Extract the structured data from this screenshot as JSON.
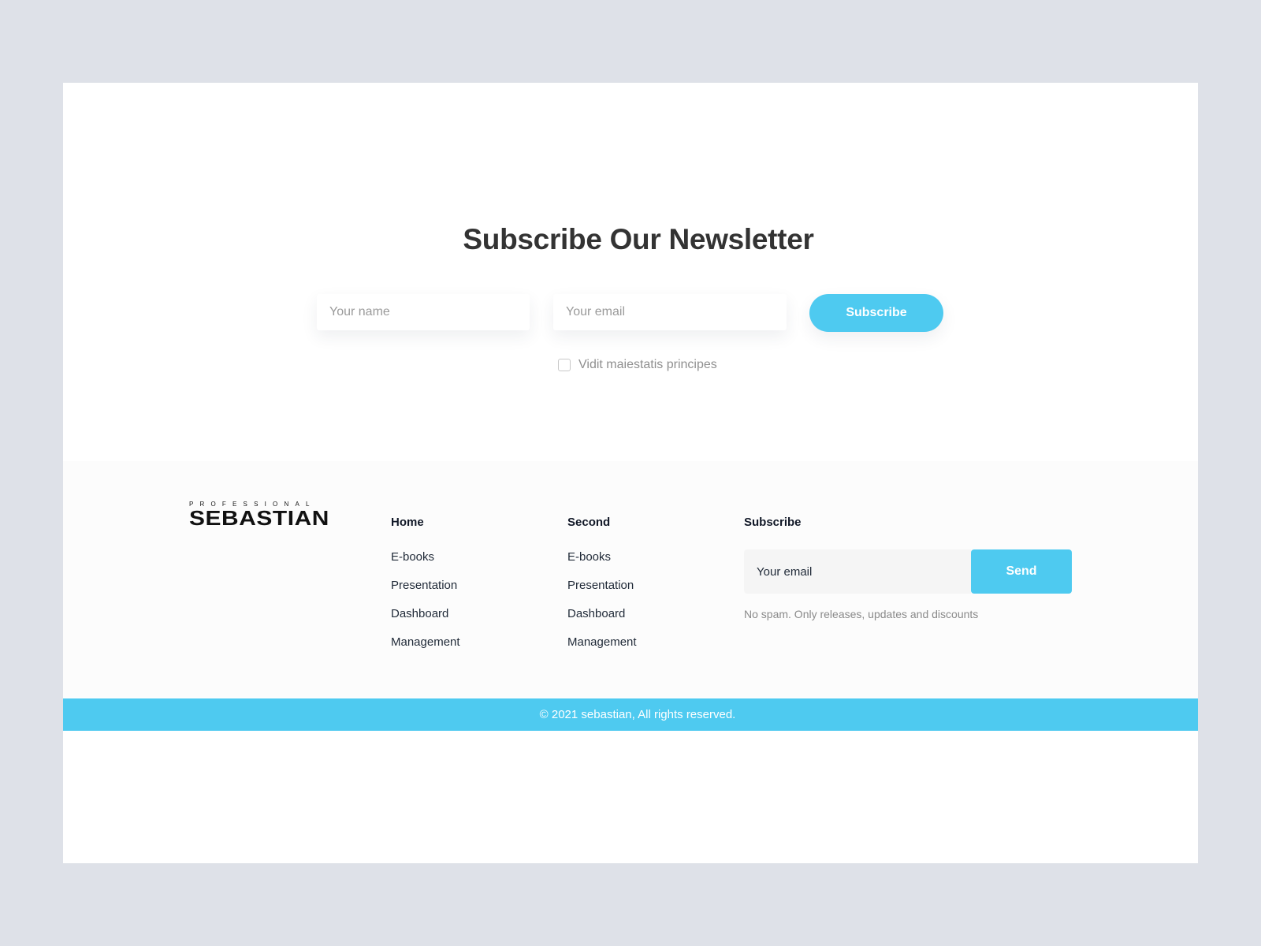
{
  "newsletter": {
    "title": "Subscribe Our Newsletter",
    "name_placeholder": "Your name",
    "email_placeholder": "Your email",
    "subscribe_label": "Subscribe",
    "checkbox_label": "Vidit maiestatis principes",
    "checkbox_checked": false
  },
  "footer": {
    "logo": {
      "top": "PROFESSIONAL",
      "main": "SEBASTIAN"
    },
    "columns": [
      {
        "heading": "Home",
        "links": [
          "E-books",
          "Presentation",
          "Dashboard",
          "Management"
        ]
      },
      {
        "heading": "Second",
        "links": [
          "E-books",
          "Presentation",
          "Dashboard",
          "Management"
        ]
      }
    ],
    "subscribe": {
      "heading": "Subscribe",
      "email_placeholder": "Your email",
      "send_label": "Send",
      "note": "No spam. Only releases, updates and discounts"
    },
    "copyright": "© 2021 sebastian, All rights reserved."
  },
  "colors": {
    "accent": "#4ecaf0",
    "page_background": "#dee1e8",
    "title": "#333333"
  }
}
